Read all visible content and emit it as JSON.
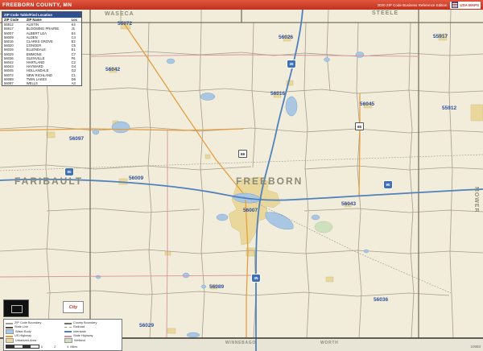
{
  "header": {
    "title": "FREEBORN COUNTY, MN",
    "edition": "2020 ZIP Code Business Reference Edition",
    "logo_label": "USA MAPS"
  },
  "zip_table": {
    "title": "ZIP Code Table/Find Location",
    "columns": [
      "ZIP Code",
      "ZIP Name",
      "Loc"
    ],
    "rows": [
      [
        "55912",
        "AUSTIN",
        "K4"
      ],
      [
        "55917",
        "BLOOMING PRAIRIE",
        "J1"
      ],
      [
        "56007",
        "ALBERT LEA",
        "E4"
      ],
      [
        "56009",
        "ALDEN",
        "C4"
      ],
      [
        "56016",
        "CLARKS GROVE",
        "E2"
      ],
      [
        "56020",
        "CONGER",
        "C5"
      ],
      [
        "56026",
        "ELLENDALE",
        "E1"
      ],
      [
        "56029",
        "EMMONS",
        "C7"
      ],
      [
        "56036",
        "GLENVILLE",
        "F6"
      ],
      [
        "56042",
        "HARTLAND",
        "C2"
      ],
      [
        "56043",
        "HAYWARD",
        "G4"
      ],
      [
        "56045",
        "HOLLANDALE",
        "G2"
      ],
      [
        "56072",
        "NEW RICHLAND",
        "C1"
      ],
      [
        "56089",
        "TWIN LAKES",
        "D6"
      ],
      [
        "56097",
        "WELLS",
        "A3"
      ]
    ]
  },
  "map": {
    "county_name": "FREEBORN",
    "neighbor_counties": [
      "WASECA",
      "STEELE",
      "FARIBAULT",
      "MOWER",
      "WINNEBAGO",
      "WORTH"
    ],
    "zip_labels": [
      "56072",
      "56026",
      "55917",
      "56042",
      "56016",
      "56045",
      "55912",
      "56097",
      "56009",
      "56007",
      "56043",
      "56089",
      "56036",
      "56029"
    ],
    "interstate_shields": [
      "35",
      "90"
    ],
    "us_shields": [
      "69",
      "65"
    ],
    "map_number": "10983"
  },
  "legend": {
    "items": [
      {
        "label": "ZIP Code Boundary",
        "type": "line",
        "color": "#a69d8c"
      },
      {
        "label": "County Boundary",
        "type": "line",
        "color": "#75725f"
      },
      {
        "label": "State Line",
        "type": "line",
        "color": "#4c4c44"
      },
      {
        "label": "Railroad",
        "type": "dash",
        "color": "#9a9a8e"
      },
      {
        "label": "Water Body",
        "type": "fill",
        "color": "#a9c6e3"
      },
      {
        "label": "Interstate",
        "type": "line",
        "color": "#4f81bd"
      },
      {
        "label": "US Highway",
        "type": "line",
        "color": "#e59a38"
      },
      {
        "label": "State Highway",
        "type": "line",
        "color": "#d9929f"
      },
      {
        "label": "Urbanized Area",
        "type": "fill",
        "color": "#e9d79c"
      },
      {
        "label": "Wetland",
        "type": "fill",
        "color": "#cfe0bf"
      }
    ]
  },
  "scale": {
    "ticks": [
      "0",
      "2",
      "4"
    ],
    "unit": "Miles"
  },
  "footer_logo": "City"
}
